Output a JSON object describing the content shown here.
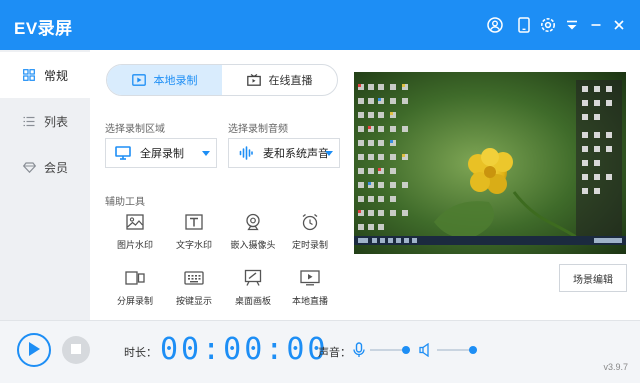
{
  "app": {
    "title": "EV录屏"
  },
  "titlebar_icons": [
    "user-icon",
    "phone-icon",
    "settings-icon",
    "dropdown-icon",
    "minimize-icon",
    "close-icon"
  ],
  "sidebar": {
    "items": [
      {
        "label": "常规",
        "icon": "grid-icon",
        "active": true
      },
      {
        "label": "列表",
        "icon": "list-icon",
        "active": false
      },
      {
        "label": "会员",
        "icon": "diamond-icon",
        "active": false
      }
    ]
  },
  "mode_tabs": [
    {
      "label": "本地录制",
      "icon": "record-icon",
      "active": true
    },
    {
      "label": "在线直播",
      "icon": "live-icon",
      "active": false
    }
  ],
  "region": {
    "label": "选择录制区域",
    "value": "全屏录制",
    "icon": "monitor-icon"
  },
  "audio": {
    "label": "选择录制音频",
    "value": "麦和系统声音",
    "icon": "audio-wave-icon"
  },
  "tools": {
    "label": "辅助工具",
    "items": [
      {
        "label": "图片水印",
        "icon": "image-icon"
      },
      {
        "label": "文字水印",
        "icon": "text-icon"
      },
      {
        "label": "嵌入摄像头",
        "icon": "webcam-icon"
      },
      {
        "label": "定时录制",
        "icon": "alarm-clock-icon"
      },
      {
        "label": "分屏录制",
        "icon": "split-screen-icon"
      },
      {
        "label": "按键显示",
        "icon": "keyboard-icon"
      },
      {
        "label": "桌面画板",
        "icon": "drawing-board-icon"
      },
      {
        "label": "本地直播",
        "icon": "local-live-icon"
      }
    ]
  },
  "scene_button": {
    "label": "场景编辑"
  },
  "bottom": {
    "duration_label": "时长：",
    "timer": "00:00:00",
    "volume_label": "声音：",
    "mic_level": 0.9,
    "speaker_level": 0.9,
    "version": "v3.9.7"
  },
  "colors": {
    "accent": "#1d8ef5",
    "tab_active_bg": "#d9ecfd",
    "sidebar_bg": "#eef0f3"
  }
}
